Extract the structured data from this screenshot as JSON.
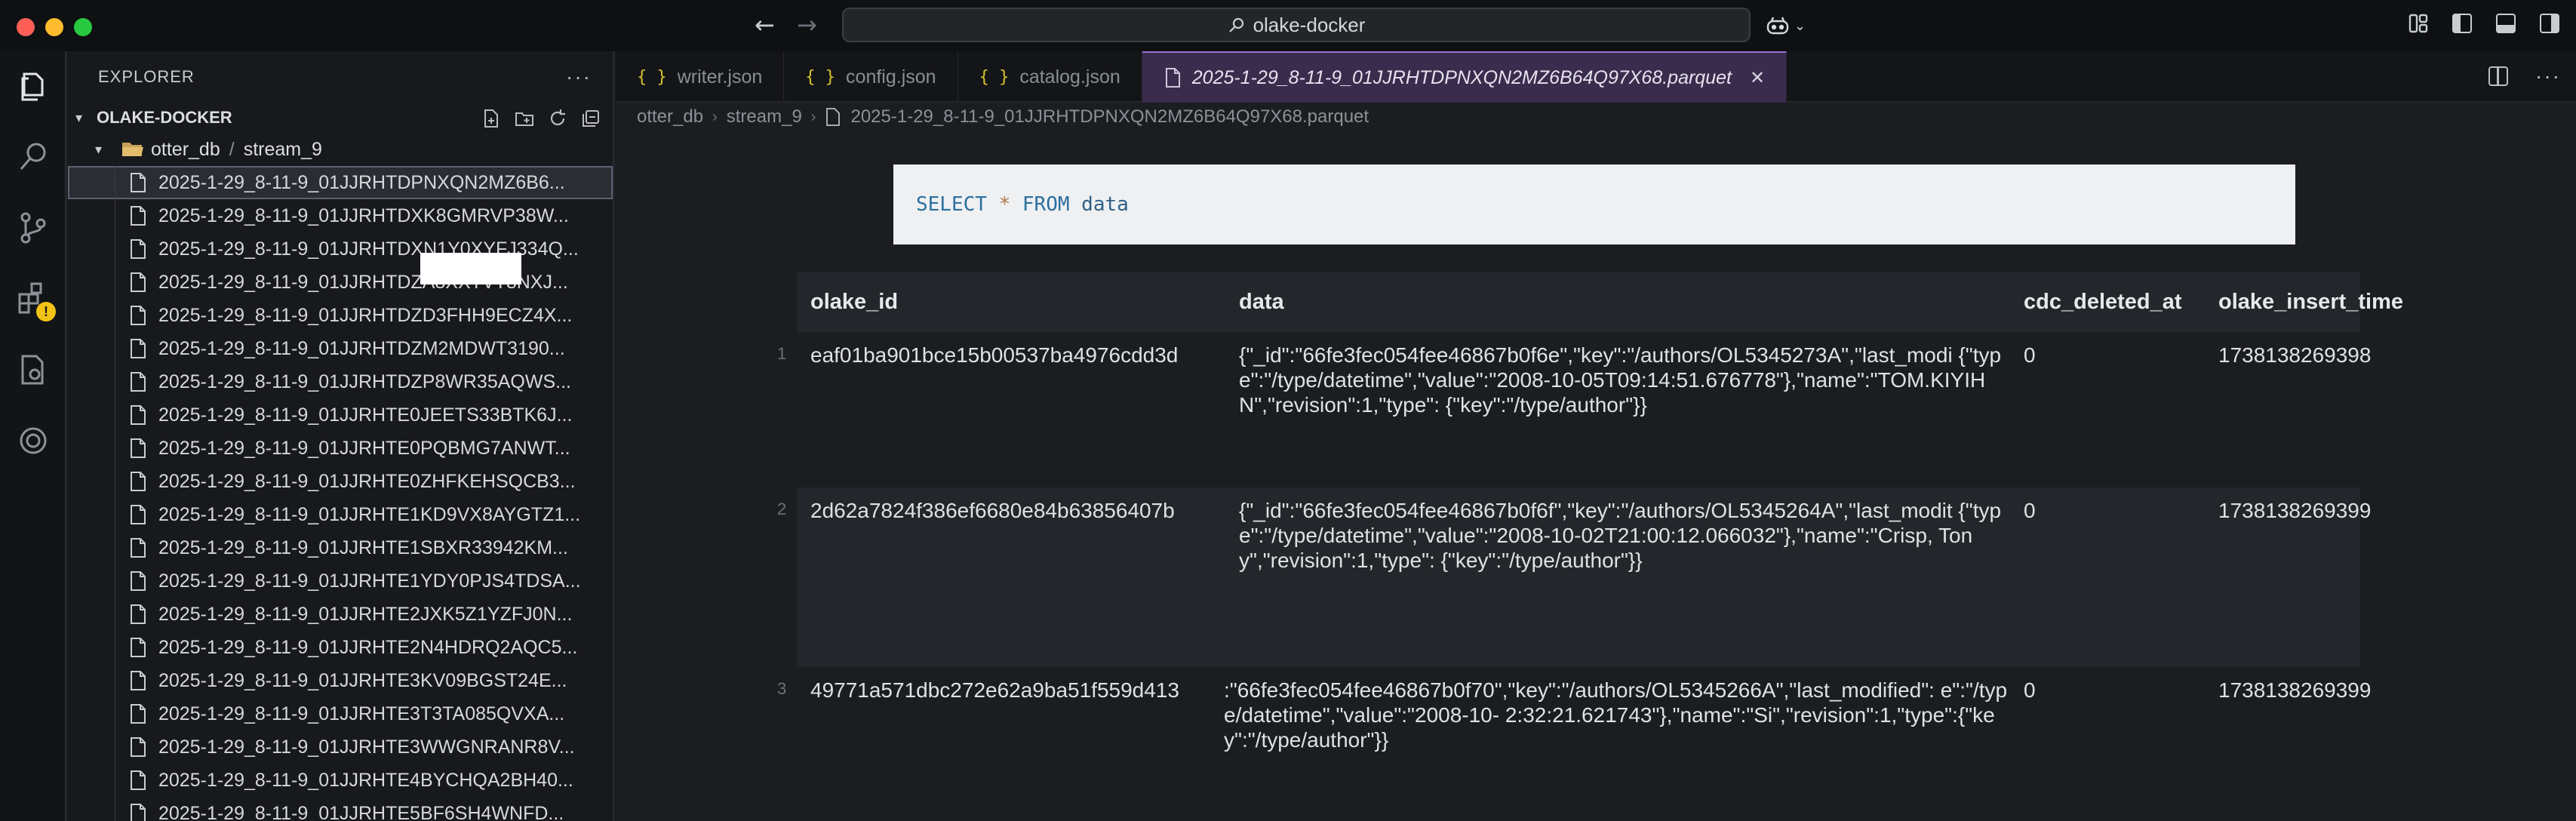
{
  "window": {
    "search_text": "olake-docker"
  },
  "sidebar": {
    "header": "EXPLORER",
    "section": "OLAKE-DOCKER",
    "folder": {
      "part1": "otter_db",
      "separator": "/",
      "part2": "stream_9"
    },
    "files": [
      "2025-1-29_8-11-9_01JJRHTDPNXQN2MZ6B6...",
      "2025-1-29_8-11-9_01JJRHTDXK8GMRVP38W...",
      "2025-1-29_8-11-9_01JJRHTDXN1Y0XYFJ334Q...",
      "2025-1-29_8-11-9_01JJRHTDZA8XXTVT8NXJ...",
      "2025-1-29_8-11-9_01JJRHTDZD3FHH9ECZ4X...",
      "2025-1-29_8-11-9_01JJRHTDZM2MDWT3190...",
      "2025-1-29_8-11-9_01JJRHTDZP8WR35AQWS...",
      "2025-1-29_8-11-9_01JJRHTE0JEETS33BTK6J...",
      "2025-1-29_8-11-9_01JJRHTE0PQBMG7ANWT...",
      "2025-1-29_8-11-9_01JJRHTE0ZHFKEHSQCB3...",
      "2025-1-29_8-11-9_01JJRHTE1KD9VX8AYGTZ1...",
      "2025-1-29_8-11-9_01JJRHTE1SBXR33942KM...",
      "2025-1-29_8-11-9_01JJRHTE1YDY0PJS4TDSA...",
      "2025-1-29_8-11-9_01JJRHTE2JXK5Z1YZFJ0N...",
      "2025-1-29_8-11-9_01JJRHTE2N4HDRQ2AQC5...",
      "2025-1-29_8-11-9_01JJRHTE3KV09BGST24E...",
      "2025-1-29_8-11-9_01JJRHTE3T3TA085QVXA...",
      "2025-1-29_8-11-9_01JJRHTE3WWGNRANR8V...",
      "2025-1-29_8-11-9_01JJRHTE4BYCHQA2BH40...",
      "2025-1-29_8-11-9_01JJRHTE5BF6SH4WNFD..."
    ]
  },
  "tabs": [
    {
      "label": "writer.json"
    },
    {
      "label": "config.json"
    },
    {
      "label": "catalog.json"
    },
    {
      "label": "2025-1-29_8-11-9_01JJRHTDPNXQN2MZ6B64Q97X68.parquet"
    }
  ],
  "breadcrumb": {
    "part1": "otter_db",
    "part2": "stream_9",
    "part3": "2025-1-29_8-11-9_01JJRHTDPNXQN2MZ6B64Q97X68.parquet"
  },
  "query": {
    "select": "SELECT",
    "star": "*",
    "from": "FROM",
    "table": "data"
  },
  "table": {
    "columns": [
      "olake_id",
      "data",
      "cdc_deleted_at",
      "olake_insert_time"
    ],
    "rows": [
      {
        "index": "1",
        "olake_id": "eaf01ba901bce15b00537ba4976cdd3d",
        "data": "{\"_id\":\"66fe3fec054fee46867b0f6e\",\"key\":\"/authors/OL5345273A\",\"last_modi {\"type\":\"/type/datetime\",\"value\":\"2008-10-05T09:14:51.676778\"},\"name\":\"TOM.KIYIHN\",\"revision\":1,\"type\": {\"key\":\"/type/author\"}}",
        "cdc_deleted_at": "0",
        "olake_insert_time": "1738138269398"
      },
      {
        "index": "2",
        "olake_id": "2d62a7824f386ef6680e84b63856407b",
        "data": "{\"_id\":\"66fe3fec054fee46867b0f6f\",\"key\":\"/authors/OL5345264A\",\"last_modit {\"type\":\"/type/datetime\",\"value\":\"2008-10-02T21:00:12.066032\"},\"name\":\"Crisp, Tony\",\"revision\":1,\"type\": {\"key\":\"/type/author\"}}",
        "cdc_deleted_at": "0",
        "olake_insert_time": "1738138269399"
      },
      {
        "index": "3",
        "olake_id": "49771a571dbc272e62a9ba51f559d413",
        "data": ":\"66fe3fec054fee46867b0f70\",\"key\":\"/authors/OL5345266A\",\"last_modified\": e\":\"/type/datetime\",\"value\":\"2008-10- 2:32:21.621743\"},\"name\":\"Si\",\"revision\":1,\"type\":{\"key\":\"/type/author\"}}",
        "cdc_deleted_at": "0",
        "olake_insert_time": "1738138269399"
      }
    ]
  }
}
